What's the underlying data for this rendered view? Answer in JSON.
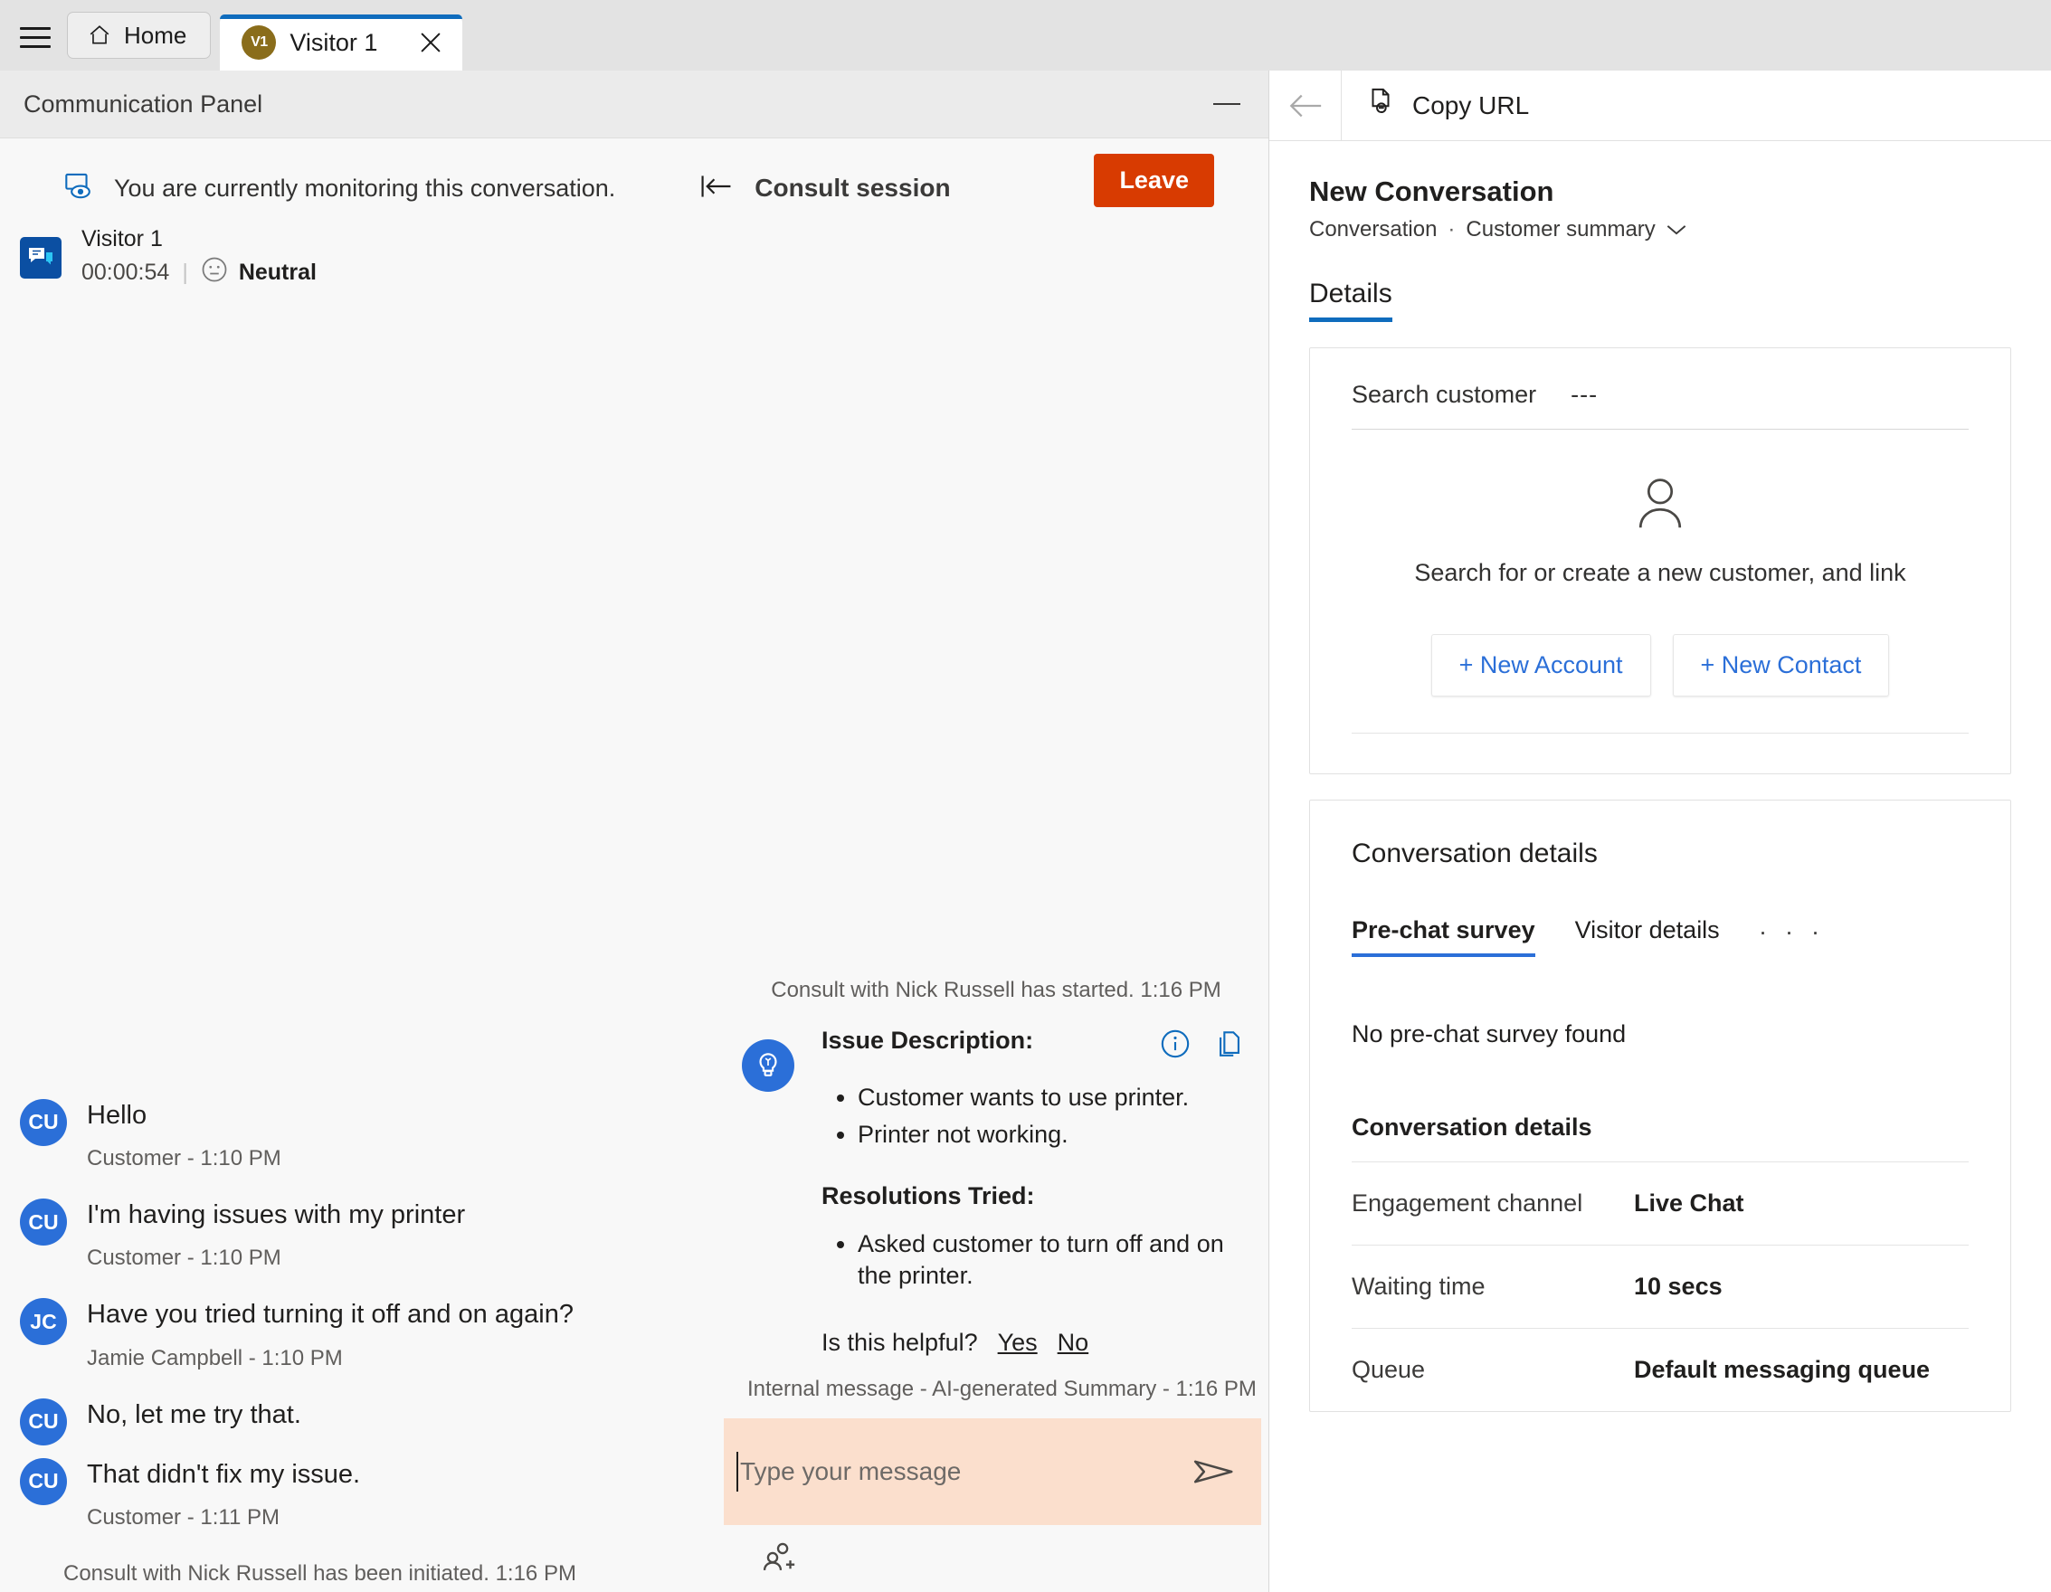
{
  "tabstrip": {
    "menu_icon": "hamburger-icon",
    "home_label": "Home",
    "tab": {
      "avatar_initials": "V1",
      "label": "Visitor 1",
      "close_icon": "close-icon"
    }
  },
  "communication_panel": {
    "title": "Communication Panel",
    "minimize_icon": "minimize-icon",
    "monitor_notice": "You are currently monitoring this conversation.",
    "monitor_icon": "monitoring-eye-icon",
    "consult_session_label": "Consult session",
    "consult_collapse_icon": "collapse-left-icon",
    "leave_label": "Leave",
    "visitor": {
      "icon": "chat-icon",
      "name": "Visitor 1",
      "timer": "00:00:54",
      "separator": "|",
      "sentiment_icon": "neutral-face-icon",
      "sentiment_label": "Neutral"
    },
    "messages": [
      {
        "avatar": "CU",
        "text": "Hello",
        "meta": "Customer - 1:10 PM"
      },
      {
        "avatar": "CU",
        "text": "I'm having issues with my printer",
        "meta": "Customer - 1:10 PM"
      },
      {
        "avatar": "JC",
        "text": "Have you tried turning it off and on again?",
        "meta": "Jamie Campbell - 1:10 PM"
      },
      {
        "avatar": "CU",
        "text": "No, let me try that.",
        "meta": ""
      },
      {
        "avatar": "CU",
        "text": "That didn't fix my issue.",
        "meta": "Customer - 1:11 PM"
      }
    ],
    "system_line": "Consult with Nick Russell has been initiated. 1:16 PM",
    "consult_started_line": "Consult with Nick Russell has started. 1:16 PM",
    "summary": {
      "bulb_icon": "lightbulb-icon",
      "info_icon": "info-icon",
      "copy_icon": "copy-icon",
      "issue_heading": "Issue Description:",
      "issue_items": [
        "Customer wants to use printer.",
        "Printer not working."
      ],
      "resolutions_heading": "Resolutions Tried:",
      "resolution_items": [
        "Asked customer to turn off and on the printer."
      ],
      "helpful_question": "Is this helpful?",
      "helpful_yes": "Yes",
      "helpful_no": "No",
      "meta": "Internal message - AI-generated Summary - 1:16 PM"
    },
    "compose": {
      "placeholder": "Type your message",
      "send_icon": "send-icon",
      "add_participant_icon": "add-participant-icon"
    }
  },
  "right_panel": {
    "back_icon": "back-arrow-icon",
    "copy_url_icon": "copy-url-icon",
    "copy_url_label": "Copy URL",
    "record_title": "New Conversation",
    "breadcrumb_entity": "Conversation",
    "breadcrumb_dot": "·",
    "breadcrumb_form": "Customer summary",
    "breadcrumb_chevron_icon": "chevron-down-icon",
    "tabs": [
      {
        "label": "Details",
        "active": true
      }
    ],
    "customer_card": {
      "search_label": "Search customer",
      "search_value": "---",
      "person_icon": "person-icon",
      "empty_text": "Search for or create a new customer, and link",
      "new_account_label": "+ New Account",
      "new_contact_label": "+ New Contact"
    },
    "conversation_details_card": {
      "title": "Conversation details",
      "tabs": [
        {
          "label": "Pre-chat survey",
          "active": true
        },
        {
          "label": "Visitor details",
          "active": false
        },
        {
          "label": ". . .",
          "active": false
        }
      ],
      "empty_text": "No pre-chat survey found",
      "subheading": "Conversation details",
      "rows": [
        {
          "key": "Engagement channel",
          "value": "Live Chat"
        },
        {
          "key": "Waiting time",
          "value": "10 secs"
        },
        {
          "key": "Queue",
          "value": "Default messaging queue"
        }
      ]
    }
  },
  "colors": {
    "accent_blue": "#0f6cbd",
    "avatar_blue": "#2b6fd8",
    "leave_orange": "#d83b01",
    "compose_peach": "#fbdfcd",
    "tab_avatar_gold": "#8a6d1b"
  }
}
